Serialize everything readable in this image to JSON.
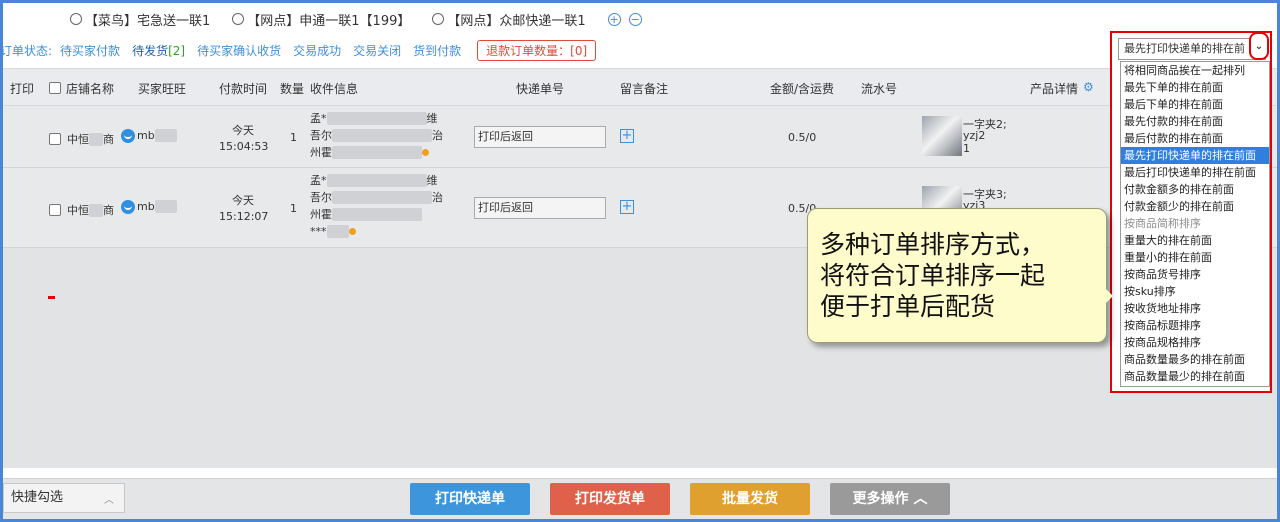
{
  "carriers": [
    {
      "label": "【菜鸟】宅急送一联1"
    },
    {
      "label": "【网点】申通一联1【199】"
    },
    {
      "label": "【网点】众邮快递一联1"
    }
  ],
  "status": {
    "label": "订单状态:",
    "links": [
      {
        "label": "待买家付款"
      },
      {
        "label": "待发货",
        "count": "[2]"
      },
      {
        "label": "待买家确认收货"
      },
      {
        "label": "交易成功"
      },
      {
        "label": "交易关闭"
      },
      {
        "label": "货到付款"
      }
    ],
    "refund": "退款订单数量：[0]"
  },
  "sort": {
    "selected": "最先打印快递单的排在前",
    "options": [
      {
        "label": "将相同商品挨在一起排列"
      },
      {
        "label": "最先下单的排在前面"
      },
      {
        "label": "最后下单的排在前面"
      },
      {
        "label": "最先付款的排在前面"
      },
      {
        "label": "最后付款的排在前面"
      },
      {
        "label": "最先打印快递单的排在前面",
        "selected": true
      },
      {
        "label": "最后打印快递单的排在前面"
      },
      {
        "label": "付款金额多的排在前面"
      },
      {
        "label": "付款金额少的排在前面"
      },
      {
        "label": "按商品简称排序",
        "dim": true
      },
      {
        "label": "重量大的排在前面"
      },
      {
        "label": "重量小的排在前面"
      },
      {
        "label": "按商品货号排序"
      },
      {
        "label": "按sku排序"
      },
      {
        "label": "按收货地址排序"
      },
      {
        "label": "按商品标题排序"
      },
      {
        "label": "按商品规格排序"
      },
      {
        "label": "商品数量最多的排在前面"
      },
      {
        "label": "商品数量最少的排在前面"
      }
    ]
  },
  "table": {
    "headers": {
      "print": "打印",
      "shop": "店铺名称",
      "buyer": "买家旺旺",
      "pay_time": "付款时间",
      "qty": "数量",
      "address": "收件信息",
      "tracking": "快递单号",
      "remark": "留言备注",
      "amount": "金额/含运费",
      "serial": "流水号",
      "product": "产品详情"
    },
    "rows": [
      {
        "shop": "中恒",
        "shop_suffix": "商",
        "buyer": "mb",
        "pay_day": "今天",
        "pay_time": "15:04:53",
        "qty": "1",
        "addr_line1": "孟*",
        "addr_line1_tail": "维",
        "addr_line2": "吾尔",
        "addr_line2_tail": "治",
        "addr_line3": "州霍",
        "tracking": "打印后返回",
        "amount": "0.5/0",
        "product_name": "一字夹2;",
        "product_sku": "yzj2",
        "product_qty": "1"
      },
      {
        "shop": "中恒",
        "shop_suffix": "商",
        "buyer": "mb",
        "pay_day": "今天",
        "pay_time": "15:12:07",
        "qty": "1",
        "addr_line1": "孟*",
        "addr_line1_tail": "维",
        "addr_line2": "吾尔",
        "addr_line2_tail": "治",
        "addr_line3": "州霍",
        "addr_line4": "***",
        "tracking": "打印后返回",
        "amount": "0.5/0",
        "product_name": "一字夹3;",
        "product_sku": "yzj3"
      }
    ]
  },
  "callout": {
    "line1": "多种订单排序方式，",
    "line2": "将符合订单排序一起",
    "line3": "便于打单后配货"
  },
  "bottom": {
    "quick_select": "快捷勾选",
    "print_express": "打印快递单",
    "print_invoice": "打印发货单",
    "batch_ship": "批量发货",
    "more_ops": "更多操作"
  },
  "colors": {
    "accent": "#3d8fdc",
    "highlight": "#e60000",
    "selected_option": "#2f7ee0",
    "callout_bg": "#fefcca"
  }
}
